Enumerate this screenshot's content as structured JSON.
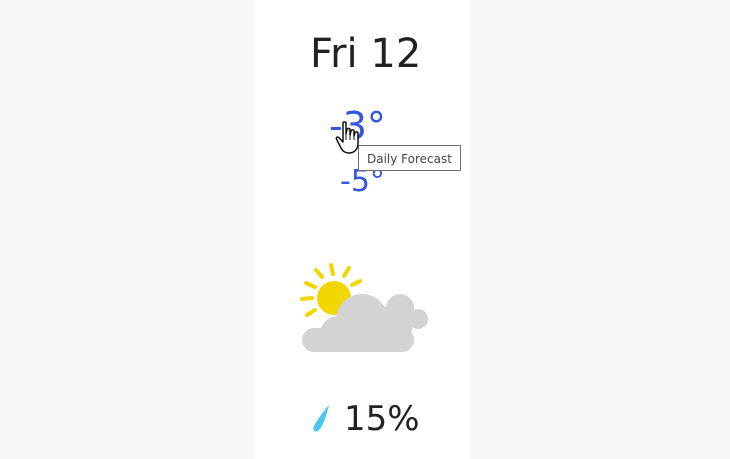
{
  "forecast": {
    "day_label": "Fri 12",
    "temp_high": "-3°",
    "temp_low": "-5°",
    "tooltip": "Daily Forecast",
    "precipitation": "15%",
    "condition_icon": "partly-cloudy-icon",
    "precip_icon": "raindrop-icon",
    "cursor_icon": "hand-pointer-icon"
  },
  "colors": {
    "temperature_text": "#3355e0",
    "primary_text": "#222222",
    "sun": "#f2d600",
    "cloud": "#d3d3d3",
    "raindrop": "#49c8f0"
  }
}
